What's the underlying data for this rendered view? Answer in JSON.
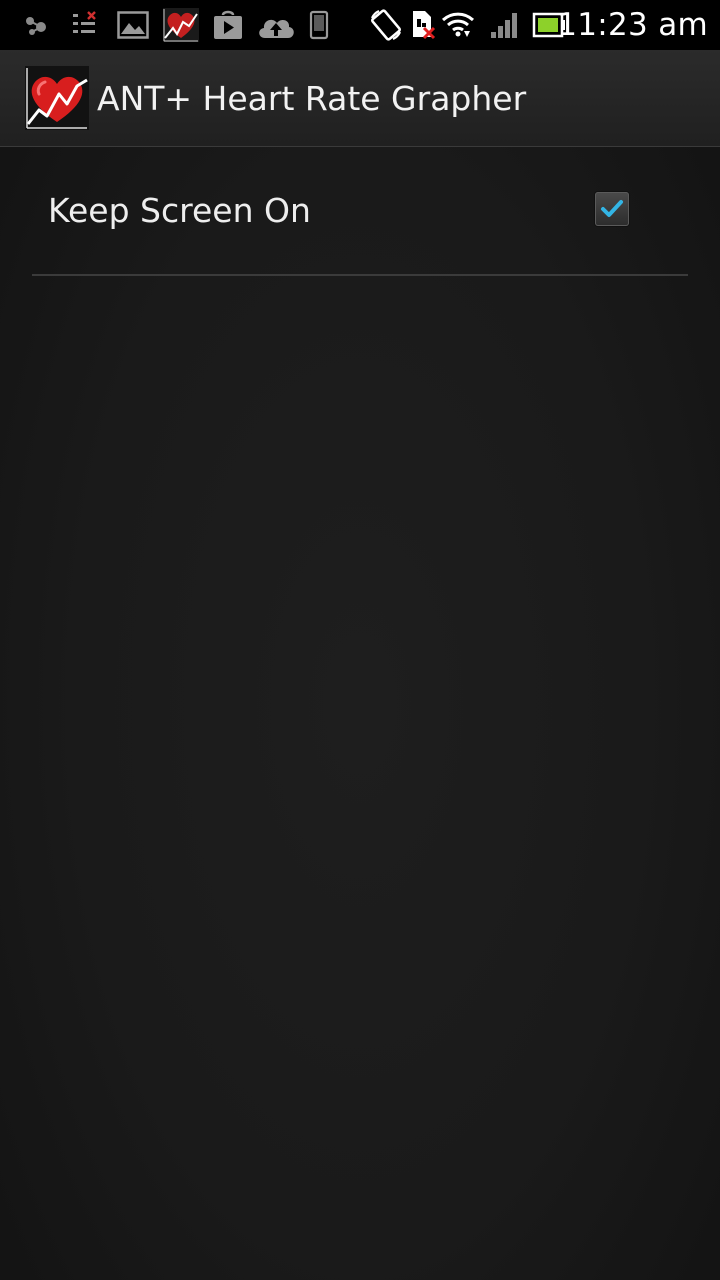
{
  "status_bar": {
    "time": "11:23 am",
    "icons": [
      "usb-debug-icon",
      "notification-list-icon",
      "picture-icon",
      "heart-rate-app-icon",
      "play-store-icon",
      "cloud-upload-icon",
      "phone-device-icon",
      "rotation-lock-icon",
      "sim-missing-icon",
      "wifi-icon",
      "cell-signal-icon",
      "battery-icon"
    ]
  },
  "action_bar": {
    "title": "ANT+ Heart Rate Grapher",
    "icon": "heart-rate-graph-icon"
  },
  "preferences": [
    {
      "label": "Keep Screen On",
      "checked": true
    }
  ],
  "colors": {
    "status_bar_bg": "#000000",
    "action_bar_bg": "#262626",
    "background": "#1a1a1a",
    "check_accent": "#33b5e5",
    "battery_fill": "#8dd12a",
    "heart_red": "#d81e1e"
  }
}
